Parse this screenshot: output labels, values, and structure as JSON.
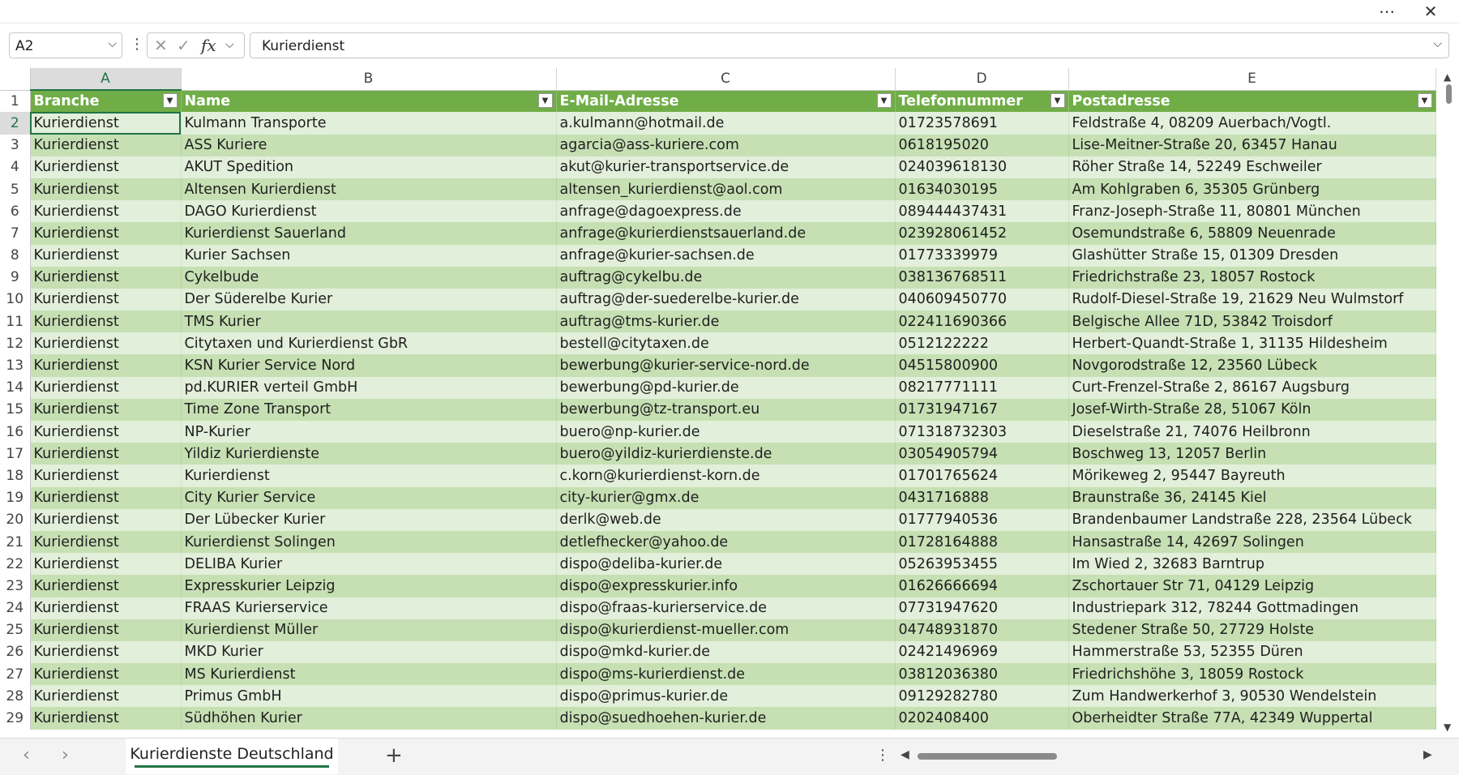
{
  "window": {
    "more_icon": "more-horizontal-icon",
    "close_icon": "close-icon"
  },
  "formula_bar": {
    "name_box": "A2",
    "formula_icon": "fx",
    "value": "Kurierdienst"
  },
  "columns": [
    "A",
    "B",
    "C",
    "D",
    "E"
  ],
  "selected_column": "A",
  "header_row": {
    "row_number": "1",
    "cells": [
      "Branche",
      "Name",
      "E-Mail-Adresse",
      "Telefonnummer",
      "Postadresse"
    ]
  },
  "rows": [
    {
      "n": "2",
      "c": [
        "Kurierdienst",
        "Kulmann Transporte",
        "a.kulmann@hotmail.de",
        "01723578691",
        "Feldstraße 4, 08209 Auerbach/Vogtl."
      ]
    },
    {
      "n": "3",
      "c": [
        "Kurierdienst",
        "ASS Kuriere",
        "agarcia@ass-kuriere.com",
        "0618195020",
        "Lise-Meitner-Straße 20, 63457 Hanau"
      ]
    },
    {
      "n": "4",
      "c": [
        "Kurierdienst",
        "AKUT Spedition",
        "akut@kurier-transportservice.de",
        "024039618130",
        "Röher Straße 14, 52249 Eschweiler"
      ]
    },
    {
      "n": "5",
      "c": [
        "Kurierdienst",
        "Altensen Kurierdienst",
        "altensen_kurierdienst@aol.com",
        "01634030195",
        "Am Kohlgraben 6, 35305 Grünberg"
      ]
    },
    {
      "n": "6",
      "c": [
        "Kurierdienst",
        "DAGO Kurierdienst",
        "anfrage@dagoexpress.de",
        "089444437431",
        "Franz-Joseph-Straße 11, 80801 München"
      ]
    },
    {
      "n": "7",
      "c": [
        "Kurierdienst",
        "Kurierdienst Sauerland",
        "anfrage@kurierdienstsauerland.de",
        "023928061452",
        "Osemundstraße 6, 58809 Neuenrade"
      ]
    },
    {
      "n": "8",
      "c": [
        "Kurierdienst",
        "Kurier Sachsen",
        "anfrage@kurier-sachsen.de",
        "01773339979",
        "Glashütter Straße 15, 01309 Dresden"
      ]
    },
    {
      "n": "9",
      "c": [
        "Kurierdienst",
        "Cykelbude",
        "auftrag@cykelbu.de",
        "038136768511",
        "Friedrichstraße 23, 18057 Rostock"
      ]
    },
    {
      "n": "10",
      "c": [
        "Kurierdienst",
        "Der Süderelbe Kurier",
        "auftrag@der-suederelbe-kurier.de",
        "040609450770",
        "Rudolf-Diesel-Straße 19, 21629 Neu Wulmstorf"
      ]
    },
    {
      "n": "11",
      "c": [
        "Kurierdienst",
        "TMS Kurier",
        "auftrag@tms-kurier.de",
        "022411690366",
        "Belgische Allee 71D, 53842 Troisdorf"
      ]
    },
    {
      "n": "12",
      "c": [
        "Kurierdienst",
        "Citytaxen und Kurierdienst GbR",
        "bestell@citytaxen.de",
        "0512122222",
        "Herbert-Quandt-Straße 1, 31135 Hildesheim"
      ]
    },
    {
      "n": "13",
      "c": [
        "Kurierdienst",
        "KSN Kurier Service Nord",
        "bewerbung@kurier-service-nord.de",
        "04515800900",
        "Novgorodstraße 12, 23560 Lübeck"
      ]
    },
    {
      "n": "14",
      "c": [
        "Kurierdienst",
        "pd.KURIER verteil GmbH",
        "bewerbung@pd-kurier.de",
        "08217771111",
        "Curt-Frenzel-Straße 2, 86167 Augsburg"
      ]
    },
    {
      "n": "15",
      "c": [
        "Kurierdienst",
        "Time Zone Transport",
        "bewerbung@tz-transport.eu",
        "01731947167",
        "Josef-Wirth-Straße 28, 51067 Köln"
      ]
    },
    {
      "n": "16",
      "c": [
        "Kurierdienst",
        "NP-Kurier",
        "buero@np-kurier.de",
        "071318732303",
        "Dieselstraße 21, 74076 Heilbronn"
      ]
    },
    {
      "n": "17",
      "c": [
        "Kurierdienst",
        "Yildiz Kurierdienste",
        "buero@yildiz-kurierdienste.de",
        "03054905794",
        "Boschweg 13, 12057 Berlin"
      ]
    },
    {
      "n": "18",
      "c": [
        "Kurierdienst",
        "Kurierdienst",
        "c.korn@kurierdienst-korn.de",
        "01701765624",
        "Mörikeweg 2, 95447 Bayreuth"
      ]
    },
    {
      "n": "19",
      "c": [
        "Kurierdienst",
        "City Kurier Service",
        "city-kurier@gmx.de",
        "0431716888",
        "Braunstraße 36, 24145 Kiel"
      ]
    },
    {
      "n": "20",
      "c": [
        "Kurierdienst",
        "Der Lübecker Kurier",
        "derlk@web.de",
        "01777940536",
        "Brandenbaumer Landstraße 228, 23564 Lübeck"
      ]
    },
    {
      "n": "21",
      "c": [
        "Kurierdienst",
        "Kurierdienst Solingen",
        "detlefhecker@yahoo.de",
        "01728164888",
        "Hansastraße 14, 42697 Solingen"
      ]
    },
    {
      "n": "22",
      "c": [
        "Kurierdienst",
        "DELIBA Kurier",
        "dispo@deliba-kurier.de",
        "05263953455",
        "Im Wied 2, 32683 Barntrup"
      ]
    },
    {
      "n": "23",
      "c": [
        "Kurierdienst",
        "Expresskurier Leipzig",
        "dispo@expresskurier.info",
        "01626666694",
        "Zschortauer Str 71, 04129 Leipzig"
      ]
    },
    {
      "n": "24",
      "c": [
        "Kurierdienst",
        "FRAAS Kurierservice",
        "dispo@fraas-kurierservice.de",
        "07731947620",
        "Industriepark 312, 78244 Gottmadingen"
      ]
    },
    {
      "n": "25",
      "c": [
        "Kurierdienst",
        "Kurierdienst Müller",
        "dispo@kurierdienst-mueller.com",
        "04748931870",
        "Stedener Straße 50, 27729 Holste"
      ]
    },
    {
      "n": "26",
      "c": [
        "Kurierdienst",
        "MKD Kurier",
        "dispo@mkd-kurier.de",
        "02421496969",
        "Hammerstraße 53, 52355 Düren"
      ]
    },
    {
      "n": "27",
      "c": [
        "Kurierdienst",
        "MS Kurierdienst",
        "dispo@ms-kurierdienst.de",
        "03812036380",
        "Friedrichshöhe 3, 18059 Rostock"
      ]
    },
    {
      "n": "28",
      "c": [
        "Kurierdienst",
        "Primus GmbH",
        "dispo@primus-kurier.de",
        "09129282780",
        "Zum Handwerkerhof 3, 90530 Wendelstein"
      ]
    },
    {
      "n": "29",
      "c": [
        "Kurierdienst",
        "Südhöhen Kurier",
        "dispo@suedhoehen-kurier.de",
        "0202408400",
        "Oberheidter Straße 77A, 42349 Wuppertal"
      ]
    }
  ],
  "sheet_tabs": [
    "Kurierdienste Deutschland"
  ],
  "active_sheet": "Kurierdienste Deutschland",
  "colors": {
    "accent": "#217346",
    "header_fill": "#70ad47",
    "band_light": "#e2efda",
    "band_dark": "#c6e0b4"
  }
}
